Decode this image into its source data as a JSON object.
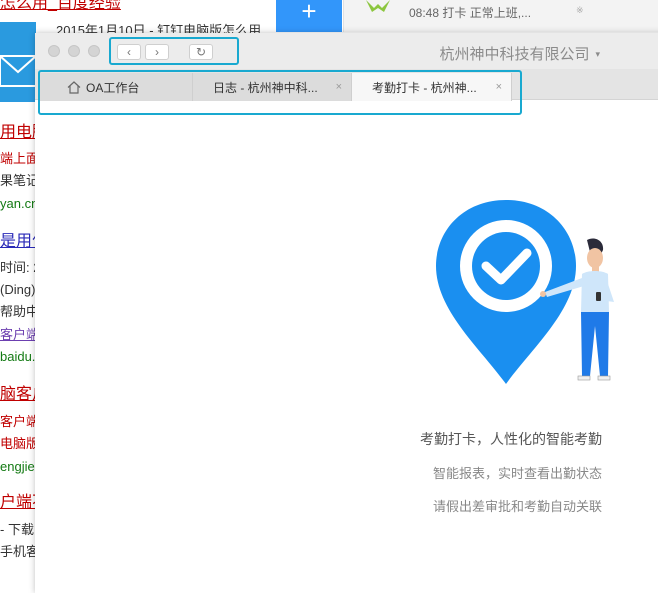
{
  "background_page": {
    "line_top": "怎么用_百度经验",
    "line_date": "2015年1月10日 - 钉钉电脑版怎么用",
    "r1_title": "用电脑",
    "r1_l1": "端上面",
    "r1_l2": "果笔记",
    "r1_url": "yan.cn",
    "r2_title": "是用什",
    "r2_l1": "时间: 2",
    "r2_l2": "(Ding)",
    "r2_l3": "帮助中",
    "r2_link": "客户端",
    "r2_url": "baidu.c",
    "r3_title": "脑客户",
    "r3_l1": "客户端",
    "r3_l2": "电脑版",
    "r3_url": "engjie",
    "r4_title": "户端不",
    "r4_l1": "- 下载",
    "r4_l2": "手机客"
  },
  "notification": {
    "plus": "+",
    "text": "08:48 打卡 正常上班,...",
    "mini": "※"
  },
  "window": {
    "company": "杭州神中科技有限公司",
    "company_caret": "▾",
    "back": "‹",
    "forward": "›",
    "reload": "↻"
  },
  "tabs": [
    {
      "label": "OA工作台"
    },
    {
      "label": "日志 - 杭州神中科...",
      "close": "×"
    },
    {
      "label": "考勤打卡 - 杭州神...",
      "close": "×"
    }
  ],
  "main": {
    "slogan": "考勤打卡，人性化的智能考勤",
    "feature1": "智能报表，实时查看出勤状态",
    "feature2": "请假出差审批和考勤自动关联"
  },
  "colors": {
    "accent": "#1a8ff0",
    "highlight_outline": "#19a9d0"
  }
}
